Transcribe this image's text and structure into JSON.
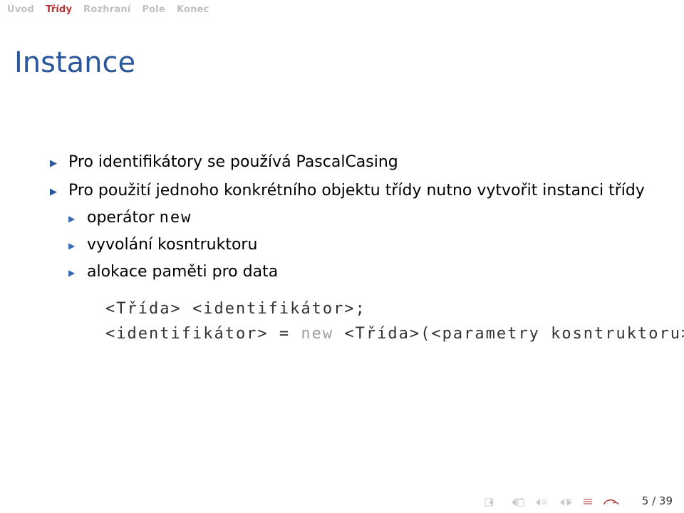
{
  "nav": {
    "items": [
      {
        "label": "Úvod",
        "active": false
      },
      {
        "label": "Třídy",
        "active": true
      },
      {
        "label": "Rozhraní",
        "active": false
      },
      {
        "label": "Pole",
        "active": false
      },
      {
        "label": "Konec",
        "active": false
      }
    ]
  },
  "title": "Instance",
  "bullets": {
    "b0": "Pro identifikátory se používá PascalCasing",
    "b1": "Pro použití jednoho konkrétního objektu třídy nutno vytvořit instanci třídy",
    "b1a_pre": "operátor ",
    "b1a_mono": "new",
    "b1b": "vyvolání kosntruktoru",
    "b1c": "alokace paměti pro data"
  },
  "code": {
    "l1": "<Třída> <identifikátor>;",
    "l2_a": "<identifikátor> = ",
    "l2_kw": "new",
    "l2_b": " <Třída>(<parametry kosntruktoru>)"
  },
  "footer": {
    "page": "5 / 39"
  }
}
